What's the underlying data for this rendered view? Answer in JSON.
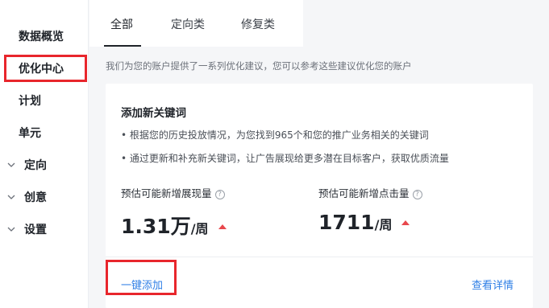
{
  "sidebar": {
    "items": [
      {
        "label": "数据概览",
        "chevron": false
      },
      {
        "label": "优化中心",
        "chevron": false,
        "active": true
      },
      {
        "label": "计划",
        "chevron": false
      },
      {
        "label": "单元",
        "chevron": false
      },
      {
        "label": "定向",
        "chevron": true
      },
      {
        "label": "创意",
        "chevron": true
      },
      {
        "label": "设置",
        "chevron": true
      }
    ]
  },
  "tabs": [
    {
      "label": "全部",
      "active": true
    },
    {
      "label": "定向类"
    },
    {
      "label": "修复类"
    }
  ],
  "description": "我们为您的账户提供了一系列优化建议，您可以参考这些建议优化您的账户",
  "card": {
    "title": "添加新关键词",
    "bullets": [
      "• 根据您的历史投放情况，为您找到965个和您的推广业务相关的关键词",
      "• 通过更新和补充新关键词，让广告展现给更多潜在目标客户，获取优质流量"
    ],
    "metrics": [
      {
        "label": "预估可能新增展现量",
        "value": "1.31万",
        "unit": "/周"
      },
      {
        "label": "预估可能新增点击量",
        "value": "1711",
        "unit": "/周"
      }
    ],
    "add_link": "一键添加",
    "detail_link": "查看详情"
  },
  "colors": {
    "accent": "#2f7fe6",
    "highlight": "#e8262c",
    "up": "#e8474c"
  }
}
